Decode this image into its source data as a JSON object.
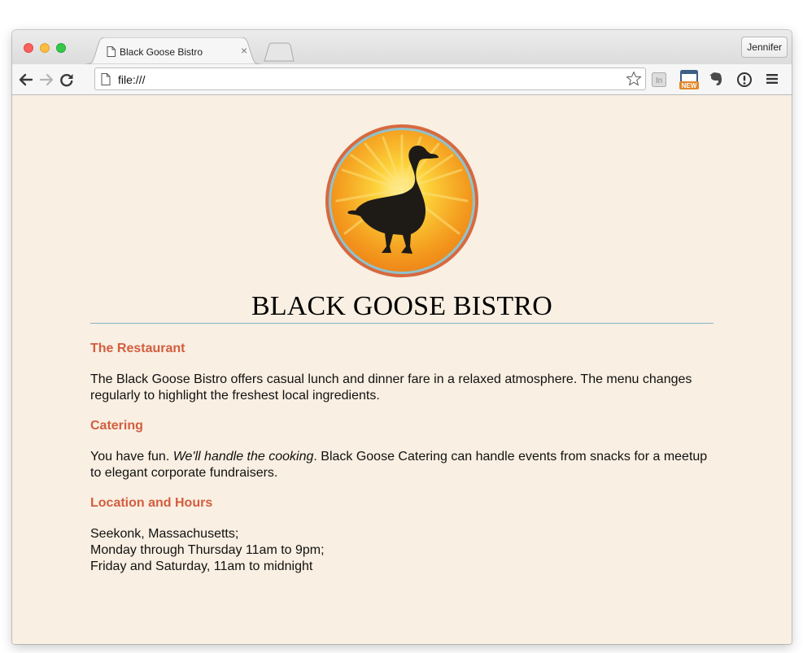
{
  "browser": {
    "tab_title": "Black Goose Bistro",
    "tab_close": "×",
    "profile_name": "Jennifer",
    "url": "file:///",
    "icons": [
      "document-icon",
      "back-icon",
      "forward-icon",
      "reload-icon",
      "star-icon",
      "linkedin-icon",
      "cast-new-icon",
      "evernote-icon",
      "info-icon",
      "menu-icon"
    ],
    "cast_badge": "NEW",
    "linkedin_badge": "In"
  },
  "page": {
    "title": "BLACK GOOSE BISTRO",
    "colors": {
      "background": "#f9efe2",
      "heading": "#d35d3f",
      "rule": "#7eb5c7"
    },
    "sections": [
      {
        "heading": "The Restaurant",
        "body": "The Black Goose Bistro offers casual lunch and dinner fare in a relaxed atmosphere. The menu changes regularly to highlight the freshest local ingredients."
      },
      {
        "heading": "Catering",
        "body_before": "You have fun. ",
        "body_emphasis": "We'll handle the cooking",
        "body_after": ". Black Goose Catering can handle events from snacks for a meetup to elegant corporate fundraisers."
      },
      {
        "heading": "Location and Hours",
        "lines": [
          "Seekonk, Massachusetts;",
          "Monday through Thursday 11am to 9pm;",
          "Friday and Saturday, 11am to midnight"
        ]
      }
    ]
  }
}
